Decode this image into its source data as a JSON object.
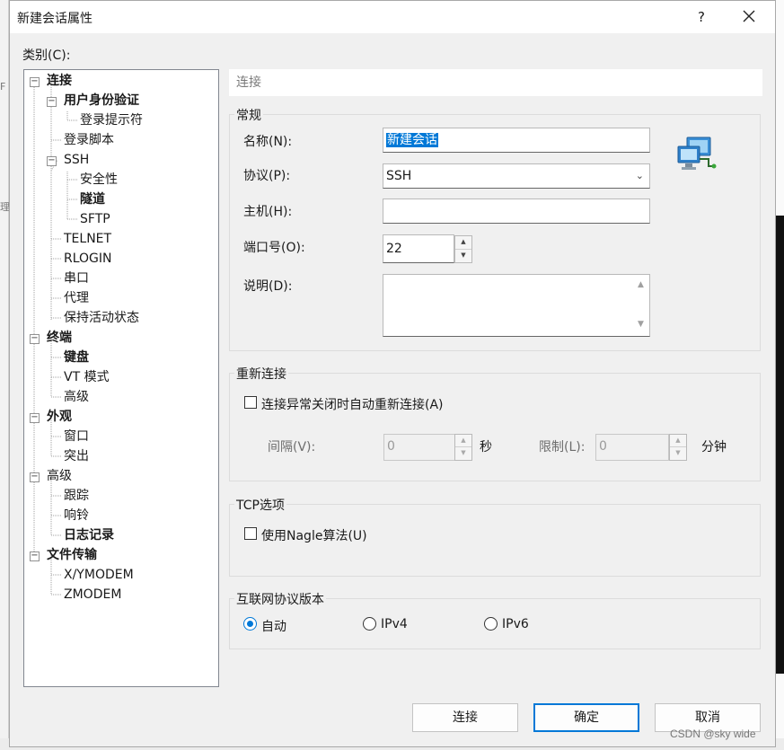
{
  "dialog": {
    "title": "新建会话属性",
    "help_label": "?",
    "category_label": "类别(C):"
  },
  "tree": {
    "connect": "连接",
    "auth": "用户身份验证",
    "login_prompt": "登录提示符",
    "login_script": "登录脚本",
    "ssh": "SSH",
    "security": "安全性",
    "tunnel": "隧道",
    "sftp": "SFTP",
    "telnet": "TELNET",
    "rlogin": "RLOGIN",
    "serial": "串口",
    "proxy": "代理",
    "keepalive": "保持活动状态",
    "terminal": "终端",
    "keyboard": "键盘",
    "vt_mode": "VT 模式",
    "advanced_term": "高级",
    "appearance": "外观",
    "window": "窗口",
    "highlight": "突出",
    "advanced": "高级",
    "trace": "跟踪",
    "bell": "响铃",
    "log": "日志记录",
    "file_transfer": "文件传输",
    "xymodem": "X/YMODEM",
    "zmodem": "ZMODEM"
  },
  "panel": {
    "title": "连接",
    "general": {
      "legend": "常规",
      "name_label": "名称(N):",
      "name_value": "新建会话",
      "protocol_label": "协议(P):",
      "protocol_value": "SSH",
      "host_label": "主机(H):",
      "host_value": "",
      "port_label": "端口号(O):",
      "port_value": "22",
      "desc_label": "说明(D):"
    },
    "reconnect": {
      "legend": "重新连接",
      "auto_label": "连接异常关闭时自动重新连接(A)",
      "interval_label": "间隔(V):",
      "interval_value": "0",
      "interval_unit": "秒",
      "limit_label": "限制(L):",
      "limit_value": "0",
      "limit_unit": "分钟"
    },
    "tcp": {
      "legend": "TCP选项",
      "nagle_label": "使用Nagle算法(U)"
    },
    "ip": {
      "legend": "互联网协议版本",
      "auto": "自动",
      "ipv4": "IPv4",
      "ipv6": "IPv6"
    }
  },
  "buttons": {
    "connect": "连接",
    "ok": "确定",
    "cancel": "取消"
  },
  "watermark": "CSDN @sky wide"
}
